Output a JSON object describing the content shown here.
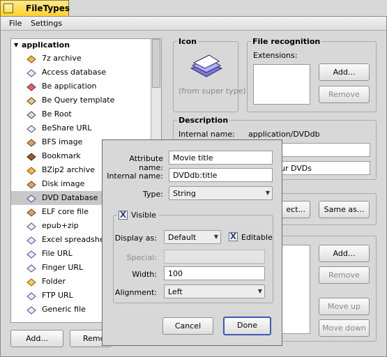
{
  "window": {
    "title": "FileTypes"
  },
  "menubar": {
    "file": "File",
    "settings": "Settings"
  },
  "list": {
    "group_label": "application",
    "items": [
      {
        "label": "7z archive",
        "icon": "archive-icon"
      },
      {
        "label": "Access database",
        "icon": "document-icon"
      },
      {
        "label": "Be application",
        "icon": "app-icon"
      },
      {
        "label": "Be Query template",
        "icon": "query-icon"
      },
      {
        "label": "Be Root",
        "icon": "root-icon"
      },
      {
        "label": "BeShare URL",
        "icon": "document-icon"
      },
      {
        "label": "BFS image",
        "icon": "package-icon"
      },
      {
        "label": "Bookmark",
        "icon": "bookmark-icon"
      },
      {
        "label": "BZip2 archive",
        "icon": "archive-icon"
      },
      {
        "label": "Disk image",
        "icon": "package-icon"
      },
      {
        "label": "DVD Database",
        "icon": "document-icon"
      },
      {
        "label": "ELF core file",
        "icon": "package-icon"
      },
      {
        "label": "epub+zip",
        "icon": "document-icon"
      },
      {
        "label": "Excel spreadsheet",
        "icon": "document-icon"
      },
      {
        "label": "File URL",
        "icon": "document-icon"
      },
      {
        "label": "Finger URL",
        "icon": "document-icon"
      },
      {
        "label": "Folder",
        "icon": "folder-icon"
      },
      {
        "label": "FTP URL",
        "icon": "document-icon"
      },
      {
        "label": "Generic file",
        "icon": "document-icon"
      }
    ],
    "selected_index": 10
  },
  "bottom_buttons": {
    "add": "Add...",
    "remove": "Remo"
  },
  "icon_group": {
    "title": "Icon",
    "caption": "(from super type)"
  },
  "file_recognition": {
    "title": "File recognition",
    "extensions_label": "Extensions:",
    "add": "Add...",
    "remove": "Remove"
  },
  "description": {
    "title": "Description",
    "internal_name_label": "Internal name:",
    "internal_name_value": "application/DVDdb",
    "desc_tail": "ur DVDs"
  },
  "preferred_app": {
    "select_tail": "ect...",
    "same_as": "Same as..."
  },
  "attributes": {
    "add": "Add...",
    "remove": "Remove",
    "move_up": "Move up",
    "move_down": "Move down"
  },
  "dialog": {
    "attribute_name_label": "Attribute name:",
    "attribute_name_value": "Movie title",
    "internal_name_label": "Internal name:",
    "internal_name_value": "DVDdb:title",
    "type_label": "Type:",
    "type_value": "String",
    "visible_label": "Visible",
    "visible_checked": "X",
    "display_as_label": "Display as:",
    "display_as_value": "Default",
    "editable_label": "Editable",
    "editable_checked": "X",
    "special_label": "Special:",
    "width_label": "Width:",
    "width_value": "100",
    "alignment_label": "Alignment:",
    "alignment_value": "Left",
    "cancel": "Cancel",
    "done": "Done"
  },
  "colors": {
    "title_tab": "#ffd22e",
    "focus": "#3a5ab8",
    "selected_row": "#c8c8c8"
  }
}
